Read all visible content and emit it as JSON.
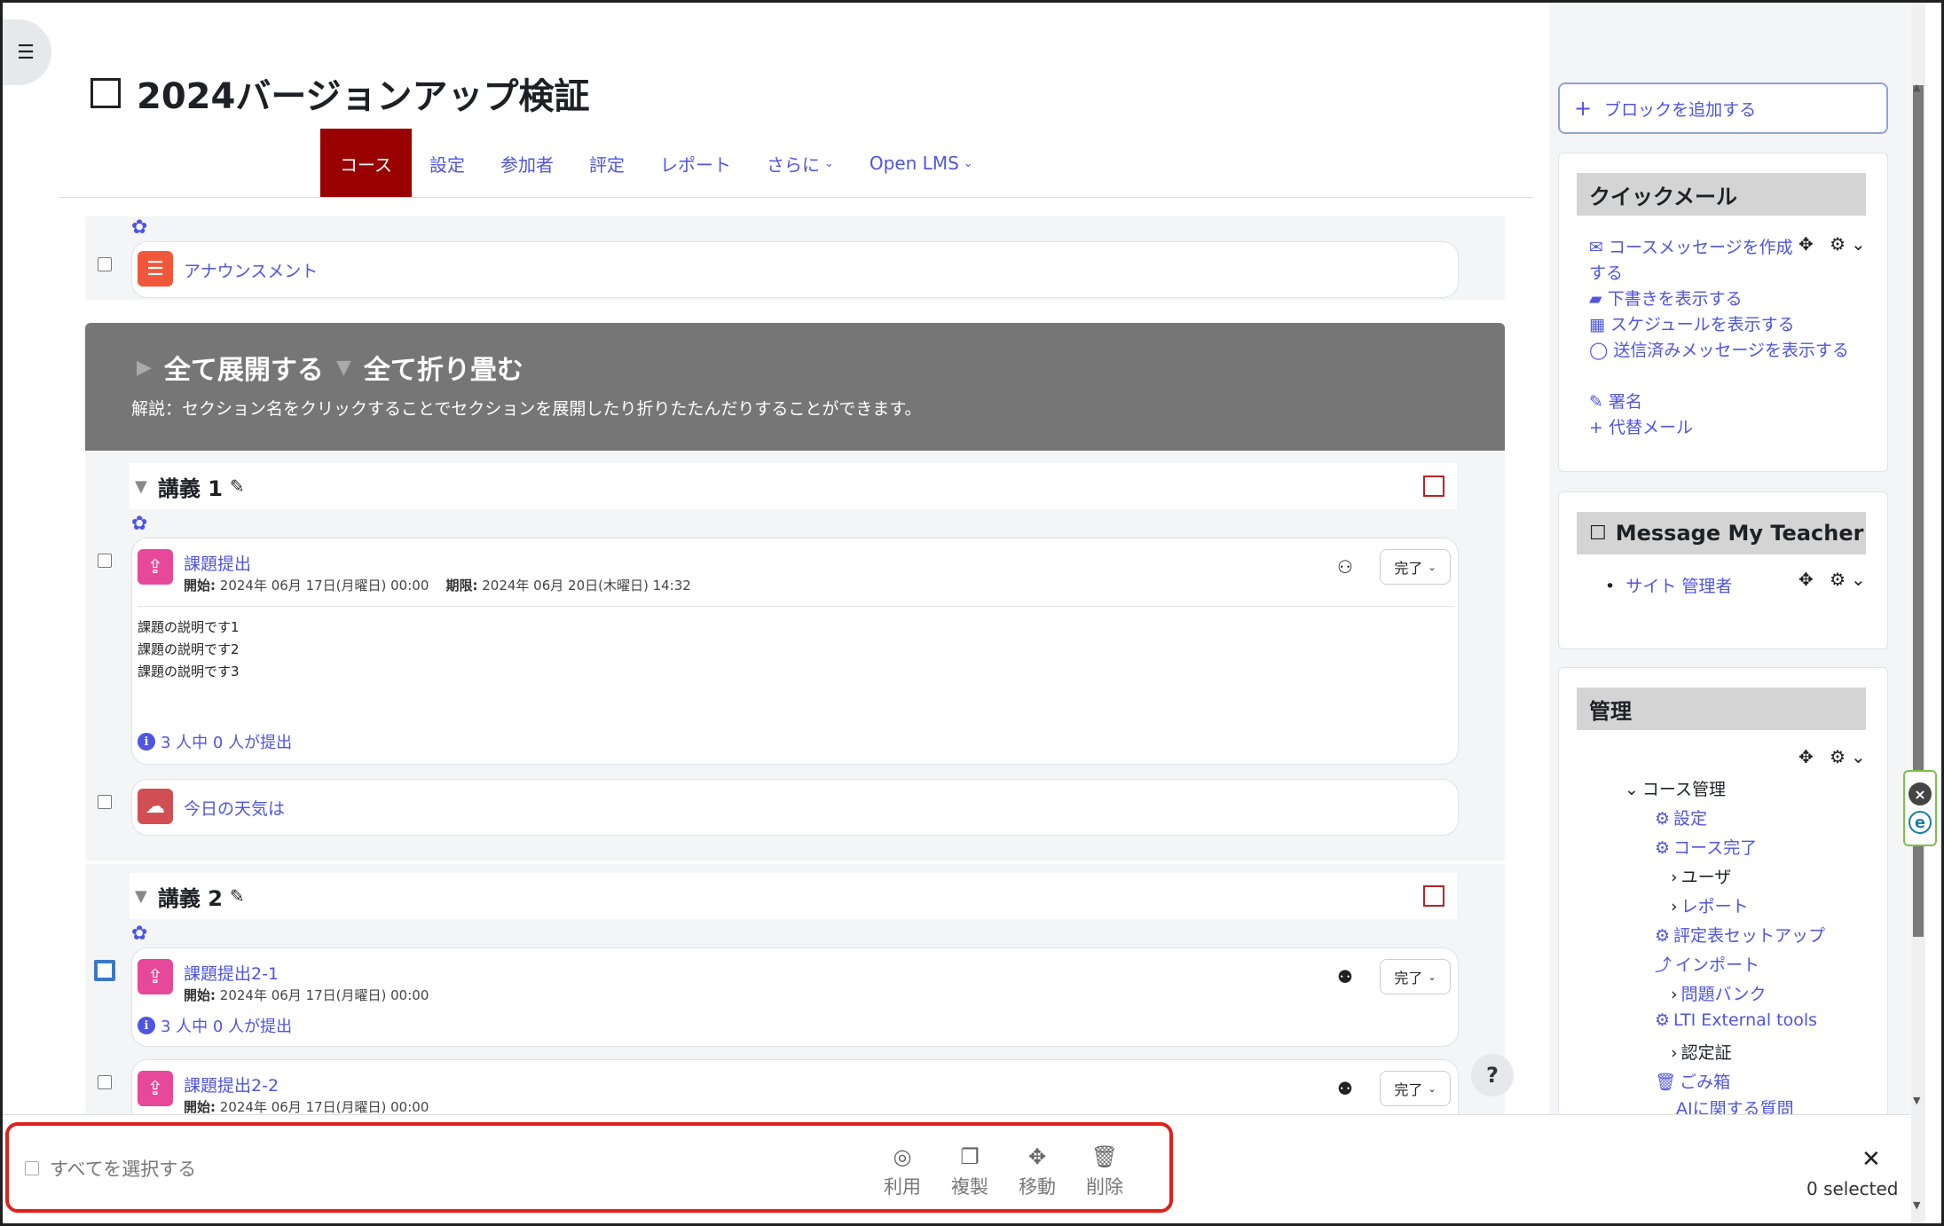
{
  "page": {
    "title": "2024バージョンアップ検証"
  },
  "tabs": [
    {
      "label": "コース"
    },
    {
      "label": "設定"
    },
    {
      "label": "参加者"
    },
    {
      "label": "評定"
    },
    {
      "label": "レポート"
    },
    {
      "label": "さらに"
    },
    {
      "label": "Open LMS"
    }
  ],
  "announcement": {
    "title": "アナウンスメント"
  },
  "banner": {
    "expand_all": "全て展開する",
    "collapse_all": "全て折り畳む",
    "note": "解説：セクション名をクリックすることでセクションを展開したり折りたたんだりすることができます。"
  },
  "section1": {
    "title": "講義 1",
    "assignment": {
      "title": "課題提出",
      "start_label": "開始:",
      "start_value": "2024年 06月 17日(月曜日) 00:00",
      "due_label": "期限:",
      "due_value": "2024年 06月 20日(木曜日) 14:32",
      "desc": [
        "課題の説明です1",
        "課題の説明です2",
        "課題の説明です3"
      ],
      "submitted": "3 人中 0 人が提出",
      "complete": "完了"
    },
    "weather": {
      "title": "今日の天気は"
    }
  },
  "section2": {
    "title": "講義 2",
    "assignment1": {
      "title": "課題提出2-1",
      "start_label": "開始:",
      "start_value": "2024年 06月 17日(月曜日) 00:00",
      "submitted": "3 人中 0 人が提出",
      "complete": "完了"
    },
    "assignment2": {
      "title": "課題提出2-2",
      "start_label": "開始:",
      "start_value": "2024年 06月 17日(月曜日) 00:00",
      "complete": "完了"
    }
  },
  "help": {
    "label": "?"
  },
  "sidebar": {
    "add_block": "ブロックを追加する",
    "quickmail": {
      "title": "クイックメール",
      "items": [
        "コースメッセージを作成する",
        "下書きを表示する",
        "スケジュールを表示する",
        "送信済みメッセージを表示する",
        "署名",
        "代替メール"
      ]
    },
    "message_teacher": {
      "title": "Message My Teacher",
      "items": [
        "サイト 管理者"
      ]
    },
    "admin": {
      "title": "管理",
      "course_admin": "コース管理",
      "items": [
        "設定",
        "コース完了",
        "ユーザ",
        "レポート",
        "評定表セットアップ",
        "インポート",
        "問題バンク",
        "LTI External tools",
        "認定証",
        "ごみ箱",
        "AIに関する質問"
      ]
    }
  },
  "bulk": {
    "select_all": "すべてを選択する",
    "availability": "利用",
    "duplicate": "複製",
    "move": "移動",
    "delete": "削除",
    "selected": "0 selected"
  },
  "colors": {
    "accent": "#4e55e0",
    "active_tab": "#9b0000",
    "banner": "#767676",
    "highlight": "#e0201a"
  }
}
